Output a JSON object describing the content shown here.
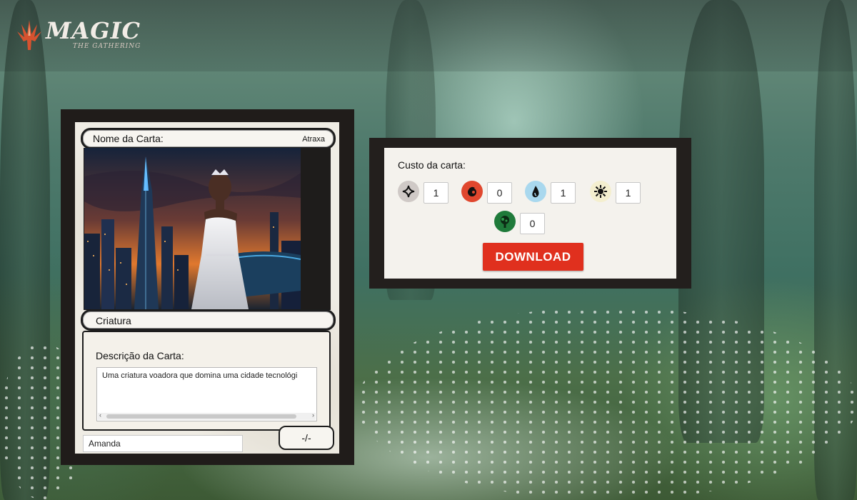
{
  "header": {
    "logo_title": "MAGIC",
    "logo_subtitle": "THE GATHERING"
  },
  "card": {
    "name_label": "Nome da Carta:",
    "name_value": "Atraxa",
    "type_label": "Criatura",
    "description_label": "Descrição da Carta:",
    "description_value": "Uma criatura voadora que domina uma cidade tecnológi",
    "author_value": "Amanda",
    "power_toughness": "-/-"
  },
  "cost_panel": {
    "title": "Custo da carta:",
    "mana": [
      {
        "icon": "colorless-mana-icon",
        "value": "1",
        "color": "#cfc9c6"
      },
      {
        "icon": "red-mana-icon",
        "value": "0",
        "color": "#e0472e"
      },
      {
        "icon": "blue-mana-icon",
        "value": "1",
        "color": "#a9d8ee"
      },
      {
        "icon": "white-mana-icon",
        "value": "1",
        "color": "#f4efcf"
      },
      {
        "icon": "green-mana-icon",
        "value": "0",
        "color": "#1f7a3a"
      }
    ],
    "download_label": "DOWNLOAD"
  },
  "colors": {
    "download": "#e0301e",
    "frame": "#201c1a",
    "card_bg": "#efece4"
  }
}
